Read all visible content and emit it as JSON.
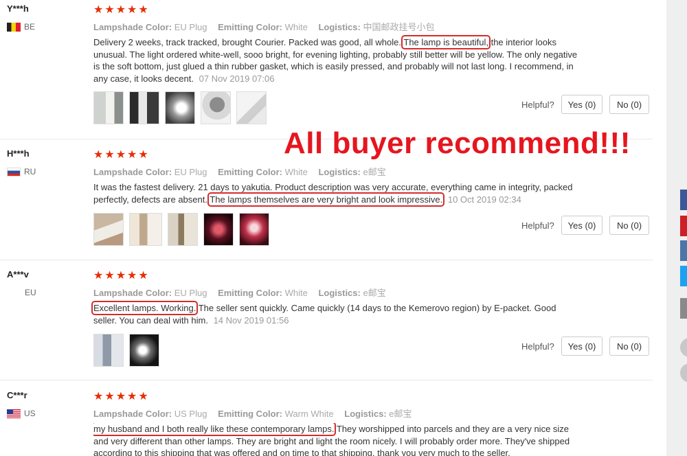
{
  "promo": "All buyer recommend!!!",
  "stars": "★★★★★",
  "labels": {
    "lampshade": "Lampshade Color:",
    "emitting": "Emitting Color:",
    "logistics": "Logistics:",
    "helpful": "Helpful?"
  },
  "reviews": [
    {
      "user": "Y***h",
      "country": "BE",
      "lampshade": "EU Plug",
      "emitting": "White",
      "logistics": "中国邮政挂号小包",
      "text_before": "Delivery 2 weeks, track tracked, brought Courier. Packed was good, all whole.",
      "highlight": "The lamp is beautiful,",
      "text_after": " the interior looks unusual. The light ordered white-well, sooo bright, for evening lighting, probably still better will be yellow. The only negative is the soft bottom, just glued a thin rubber gasket, which is easily pressed, and probably will not last long. I recommend, in any case, it looks decent.",
      "date": "07 Nov 2019 07:06",
      "yes": "Yes (0)",
      "no": "No (0)"
    },
    {
      "user": "H***h",
      "country": "RU",
      "lampshade": "EU Plug",
      "emitting": "White",
      "logistics": "e邮宝",
      "text_before": "It was the fastest delivery. 21 days to yakutia. Product description was very accurate, everything came in integrity, packed perfectly, defects are absent.",
      "highlight": "The lamps themselves are very bright and look impressive.",
      "text_after": "",
      "date": "10 Oct 2019 02:34",
      "yes": "Yes (0)",
      "no": "No (0)"
    },
    {
      "user": "A***v",
      "country": "EU",
      "lampshade": "EU Plug",
      "emitting": "White",
      "logistics": "e邮宝",
      "text_before": "",
      "highlight": "Excellent lamps. Working.",
      "text_after": " The seller sent quickly. Came quickly (14 days to the Kemerovo region) by E-packet. Good seller. You can deal with him.",
      "date": "14 Nov 2019 01:56",
      "yes": "Yes (0)",
      "no": "No (0)"
    },
    {
      "user": "C***r",
      "country": "US",
      "lampshade": "US Plug",
      "emitting": "Warm White",
      "logistics": "e邮宝",
      "text_before": "",
      "highlight": "my husband and I both really like these contemporary lamps.",
      "text_after": " They worshipped into parcels and they are a very nice size and very different than other lamps. They are bright and light the room nicely. I will probably order more. They've shipped according to this shipping that was offered and on time to that shipping, thank you very much to the seller."
    }
  ]
}
